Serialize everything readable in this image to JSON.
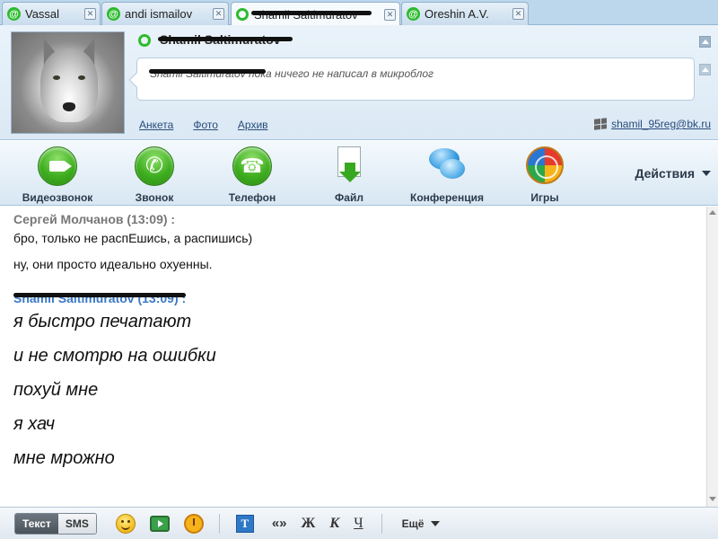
{
  "tabs": [
    {
      "label": "Vassal",
      "icon": "at-icon"
    },
    {
      "label": "andi ismailov",
      "icon": "at-icon"
    },
    {
      "label": "Shamil Saltimuratov",
      "icon": "online-status-icon",
      "active": true
    },
    {
      "label": "Oreshin A.V.",
      "icon": "at-icon"
    }
  ],
  "header": {
    "contact_name": "Shamil Saltimuratov",
    "microblog": "Shamil Saltimuratov пока ничего не написал в микроблог",
    "links": [
      "Анкета",
      "Фото",
      "Архив"
    ],
    "email": "shamil_95reg@bk.ru"
  },
  "toolbar": {
    "buttons": [
      {
        "label": "Видеозвонок",
        "icon": "video-camera-icon"
      },
      {
        "label": "Звонок",
        "icon": "phone-handset-icon"
      },
      {
        "label": "Телефон",
        "icon": "telephone-icon"
      },
      {
        "label": "Файл",
        "icon": "file-download-icon"
      },
      {
        "label": "Конференция",
        "icon": "conference-bubbles-icon"
      },
      {
        "label": "Игры",
        "icon": "games-icon"
      }
    ],
    "actions_label": "Действия"
  },
  "chat": {
    "messages": [
      {
        "sender": "Сергей Молчанов (13:09) :",
        "lines": [
          "бро, только не распЕшись, а распишись)",
          "ну, они просто идеально охуенны."
        ]
      },
      {
        "sender": "Shamil Saltimuratov (13:09) :",
        "lines": [
          "я быстро печатают",
          "и не смотрю на ошибки",
          "похуй мне",
          "я хач",
          "мне мрожно"
        ]
      }
    ]
  },
  "bottom": {
    "text_mode": "Текст",
    "sms_mode": "SMS",
    "bold": "Ж",
    "italic": "К",
    "underline": "Ч",
    "quote": "«»",
    "more": "Ещё"
  }
}
